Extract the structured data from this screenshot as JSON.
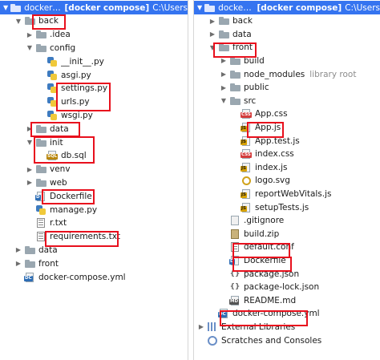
{
  "left_tree": [
    {
      "indent": 0,
      "arrow": "down",
      "icon": "folder",
      "label": "dockercompose",
      "bold_suffix": "[docker compose]",
      "extra": "C:\\Users",
      "selected": true
    },
    {
      "indent": 1,
      "arrow": "down",
      "icon": "folder",
      "label": "back"
    },
    {
      "indent": 2,
      "arrow": "right",
      "icon": "folder",
      "label": ".idea"
    },
    {
      "indent": 2,
      "arrow": "down",
      "icon": "folder",
      "label": "config"
    },
    {
      "indent": 3,
      "arrow": "",
      "icon": "py",
      "label": "__init__.py"
    },
    {
      "indent": 3,
      "arrow": "",
      "icon": "py",
      "label": "asgi.py"
    },
    {
      "indent": 3,
      "arrow": "",
      "icon": "py",
      "label": "settings.py"
    },
    {
      "indent": 3,
      "arrow": "",
      "icon": "py",
      "label": "urls.py"
    },
    {
      "indent": 3,
      "arrow": "",
      "icon": "py",
      "label": "wsgi.py"
    },
    {
      "indent": 2,
      "arrow": "right",
      "icon": "folder",
      "label": "data"
    },
    {
      "indent": 2,
      "arrow": "down",
      "icon": "folder",
      "label": "init"
    },
    {
      "indent": 3,
      "arrow": "",
      "icon": "sql",
      "label": "db.sql"
    },
    {
      "indent": 2,
      "arrow": "right",
      "icon": "folder",
      "label": "venv"
    },
    {
      "indent": 2,
      "arrow": "right",
      "icon": "folder",
      "label": "web"
    },
    {
      "indent": 2,
      "arrow": "",
      "icon": "docker",
      "label": "Dockerfile"
    },
    {
      "indent": 2,
      "arrow": "",
      "icon": "py",
      "label": "manage.py"
    },
    {
      "indent": 2,
      "arrow": "",
      "icon": "txt",
      "label": "r.txt"
    },
    {
      "indent": 2,
      "arrow": "",
      "icon": "txt",
      "label": "requirements.txt"
    },
    {
      "indent": 1,
      "arrow": "right",
      "icon": "folder",
      "label": "data"
    },
    {
      "indent": 1,
      "arrow": "right",
      "icon": "folder",
      "label": "front"
    },
    {
      "indent": 1,
      "arrow": "",
      "icon": "compose",
      "label": "docker-compose.yml"
    }
  ],
  "right_tree": [
    {
      "indent": 0,
      "arrow": "down",
      "icon": "folder",
      "label": "dockercompose",
      "bold_suffix": "[docker compose]",
      "extra": "C:\\Users",
      "selected": true
    },
    {
      "indent": 1,
      "arrow": "right",
      "icon": "folder",
      "label": "back"
    },
    {
      "indent": 1,
      "arrow": "right",
      "icon": "folder",
      "label": "data"
    },
    {
      "indent": 1,
      "arrow": "down",
      "icon": "folder",
      "label": "front"
    },
    {
      "indent": 2,
      "arrow": "right",
      "icon": "folder",
      "label": "build"
    },
    {
      "indent": 2,
      "arrow": "right",
      "icon": "folder",
      "label": "node_modules",
      "muted": "library root"
    },
    {
      "indent": 2,
      "arrow": "right",
      "icon": "folder",
      "label": "public"
    },
    {
      "indent": 2,
      "arrow": "down",
      "icon": "folder",
      "label": "src"
    },
    {
      "indent": 3,
      "arrow": "",
      "icon": "css",
      "label": "App.css"
    },
    {
      "indent": 3,
      "arrow": "",
      "icon": "js",
      "label": "App.js"
    },
    {
      "indent": 3,
      "arrow": "",
      "icon": "js",
      "label": "App.test.js"
    },
    {
      "indent": 3,
      "arrow": "",
      "icon": "css",
      "label": "index.css"
    },
    {
      "indent": 3,
      "arrow": "",
      "icon": "js",
      "label": "index.js"
    },
    {
      "indent": 3,
      "arrow": "",
      "icon": "svg",
      "label": "logo.svg"
    },
    {
      "indent": 3,
      "arrow": "",
      "icon": "js",
      "label": "reportWebVitals.js"
    },
    {
      "indent": 3,
      "arrow": "",
      "icon": "js",
      "label": "setupTests.js"
    },
    {
      "indent": 2,
      "arrow": "",
      "icon": "git",
      "label": ".gitignore"
    },
    {
      "indent": 2,
      "arrow": "",
      "icon": "zip",
      "label": "build.zip"
    },
    {
      "indent": 2,
      "arrow": "",
      "icon": "txt",
      "label": "default.conf"
    },
    {
      "indent": 2,
      "arrow": "",
      "icon": "docker",
      "label": "Dockerfile"
    },
    {
      "indent": 2,
      "arrow": "",
      "icon": "json",
      "label": "package.json"
    },
    {
      "indent": 2,
      "arrow": "",
      "icon": "json",
      "label": "package-lock.json"
    },
    {
      "indent": 2,
      "arrow": "",
      "icon": "md",
      "label": "README.md"
    },
    {
      "indent": 1,
      "arrow": "",
      "icon": "compose",
      "label": "docker-compose.yml"
    },
    {
      "indent": 0,
      "arrow": "right",
      "icon": "libraries",
      "label": "External Libraries"
    },
    {
      "indent": 0,
      "arrow": "",
      "icon": "scratches",
      "label": "Scratches and Consoles"
    }
  ],
  "highlighted": {
    "left": [
      "back",
      "settings.py",
      "urls.py",
      "data",
      "init",
      "db.sql",
      "Dockerfile",
      "requirements.txt"
    ],
    "right": [
      "front",
      "App.js",
      "default.conf",
      "Dockerfile",
      "docker-compose.yml"
    ]
  },
  "colors": {
    "selection": "#3574f0",
    "highlight_box": "#e8101d",
    "folder": "#9aa7b0"
  }
}
